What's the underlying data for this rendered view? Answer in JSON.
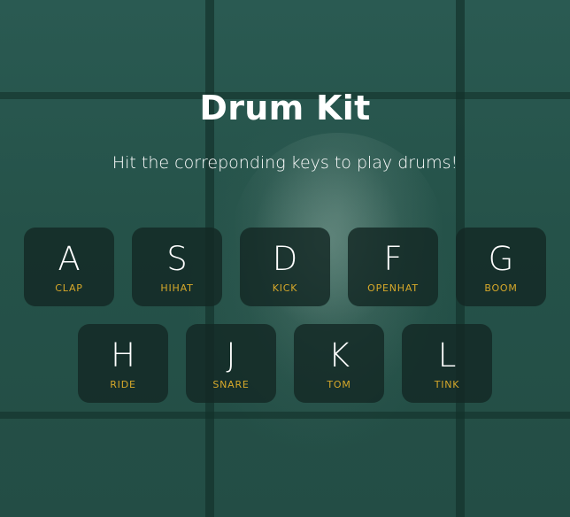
{
  "page": {
    "title": "Drum Kit",
    "subtitle": "Hit the correponding keys to play drums!"
  },
  "colors": {
    "background": "#245048",
    "key_background": "#14282499",
    "title": "#ffffff",
    "sound_label": "#d6a82a"
  },
  "keys": [
    {
      "letter": "A",
      "sound": "CLAP"
    },
    {
      "letter": "S",
      "sound": "HIHAT"
    },
    {
      "letter": "D",
      "sound": "KICK"
    },
    {
      "letter": "F",
      "sound": "OPENHAT"
    },
    {
      "letter": "G",
      "sound": "BOOM"
    },
    {
      "letter": "H",
      "sound": "RIDE"
    },
    {
      "letter": "J",
      "sound": "SNARE"
    },
    {
      "letter": "K",
      "sound": "TOM"
    },
    {
      "letter": "L",
      "sound": "TINK"
    }
  ]
}
